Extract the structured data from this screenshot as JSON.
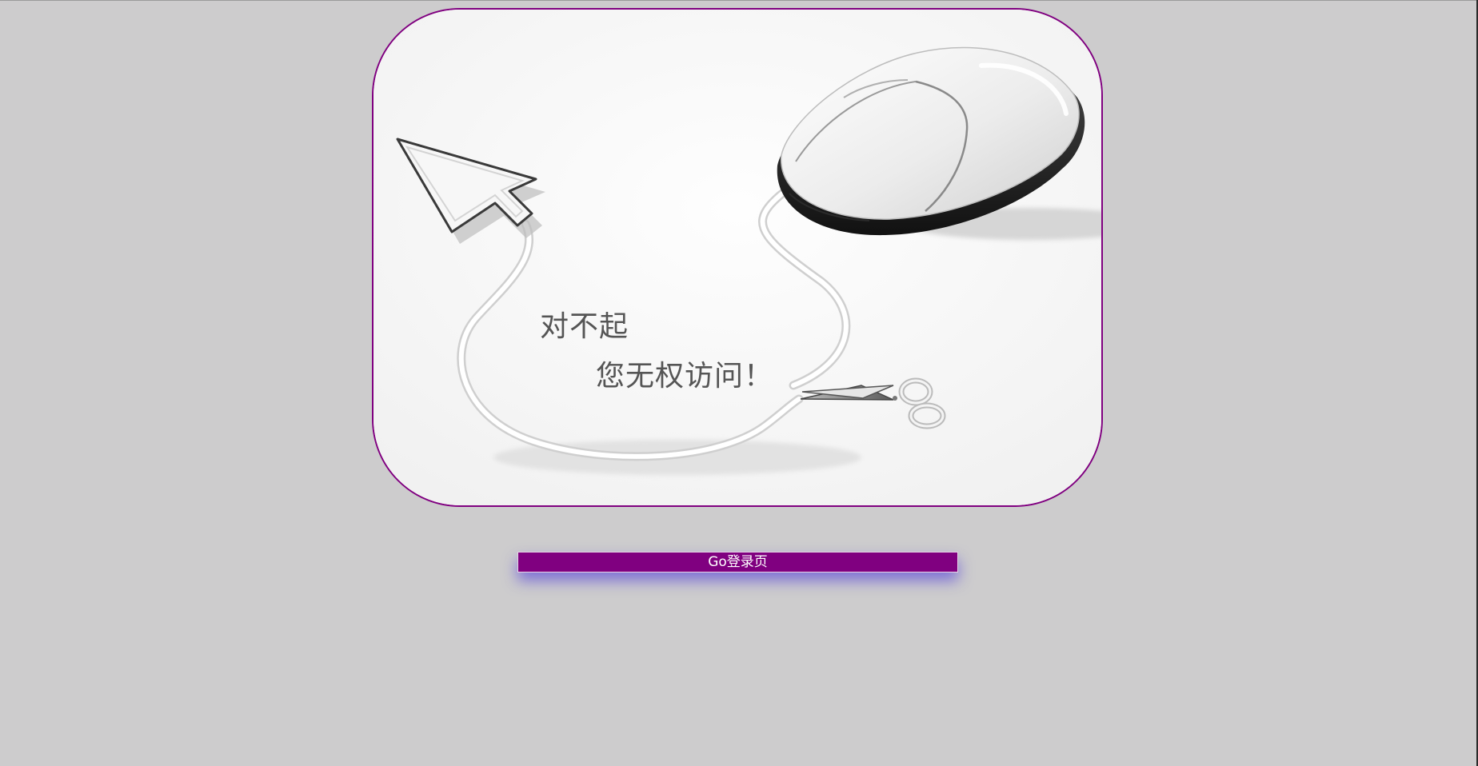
{
  "message": {
    "line1": "对不起",
    "line2": "您无权访问！"
  },
  "actions": {
    "login_label": "Go登录页"
  },
  "colors": {
    "page_background": "#cdcccd",
    "accent": "#800080",
    "button_glow": "#4a36dc"
  },
  "icons": {
    "cursor": "mouse-cursor-arrow-icon",
    "mouse": "computer-mouse-icon",
    "scissors": "scissors-icon"
  }
}
